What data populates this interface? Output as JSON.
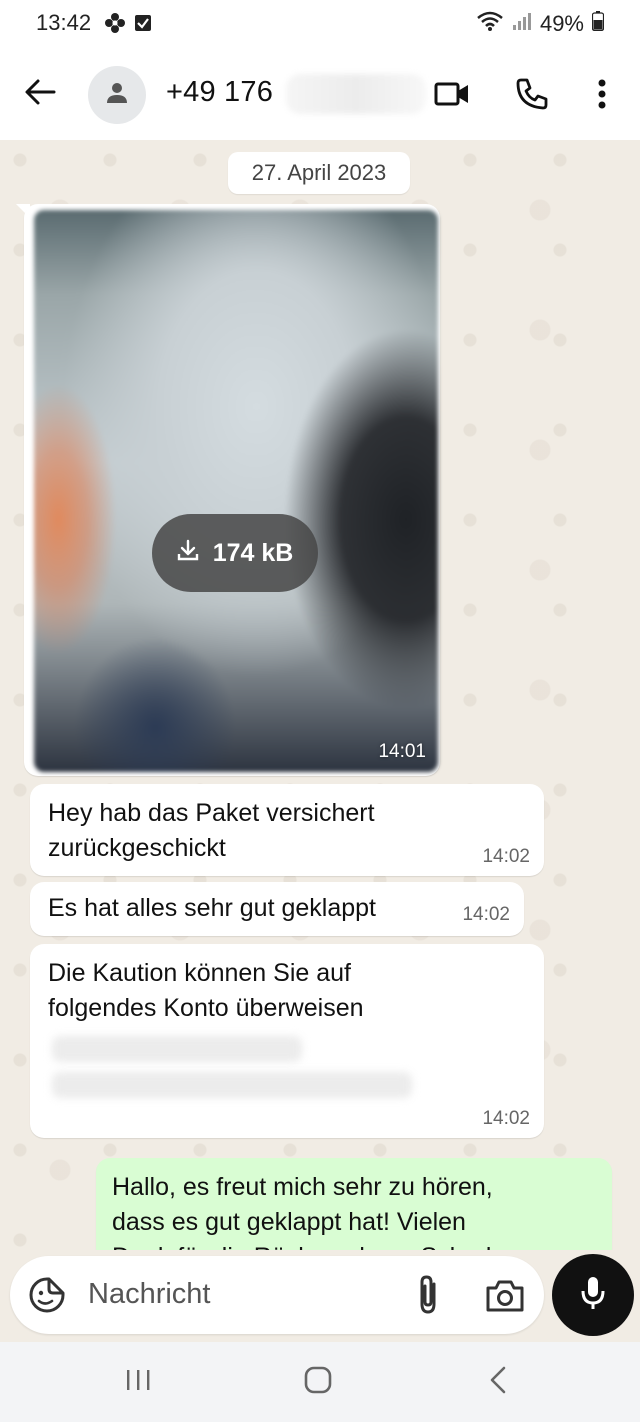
{
  "status_bar": {
    "time": "13:42",
    "battery": "49%",
    "icons": [
      "flower-icon",
      "checkbox-icon",
      "wifi-icon",
      "signal-icon",
      "battery-icon"
    ]
  },
  "header": {
    "back_icon": "arrow-left-icon",
    "avatar_icon": "person-icon",
    "contact_name": "+49 176",
    "video_call_icon": "videocam-icon",
    "voice_call_icon": "phone-icon",
    "menu_icon": "more-vertical-icon"
  },
  "chat": {
    "date_label": "27. April 2023",
    "image_message": {
      "download_size": "174 kB",
      "time": "14:01"
    },
    "messages": [
      {
        "text_line1": "Hey hab das Paket versichert",
        "text_line2": "zurückgeschickt",
        "time": "14:02"
      },
      {
        "text_line1": "Es hat alles sehr gut geklappt",
        "time": "14:02"
      },
      {
        "text_line1": "Die Kaution können Sie auf",
        "text_line2": "folgendes Konto überweisen",
        "time": "14:02"
      }
    ],
    "outgoing": {
      "text_line1": "Hallo, es freut mich sehr zu hören,",
      "text_line2": "dass es gut geklappt hat! Vielen",
      "text_line3": "Dank für die Rücksendung. Schade"
    }
  },
  "input_bar": {
    "placeholder": "Nachricht",
    "emoji_icon": "sticker-icon",
    "attach_icon": "paperclip-icon",
    "camera_icon": "camera-icon",
    "mic_icon": "mic-icon"
  },
  "nav_bar": {
    "icons": [
      "recent-apps-icon",
      "home-icon",
      "back-chevron-icon"
    ]
  },
  "colors": {
    "chat_background": "#f1ece4",
    "outgoing_bubble": "#d9fdd3",
    "incoming_bubble": "#ffffff",
    "mic_button": "#111111"
  }
}
